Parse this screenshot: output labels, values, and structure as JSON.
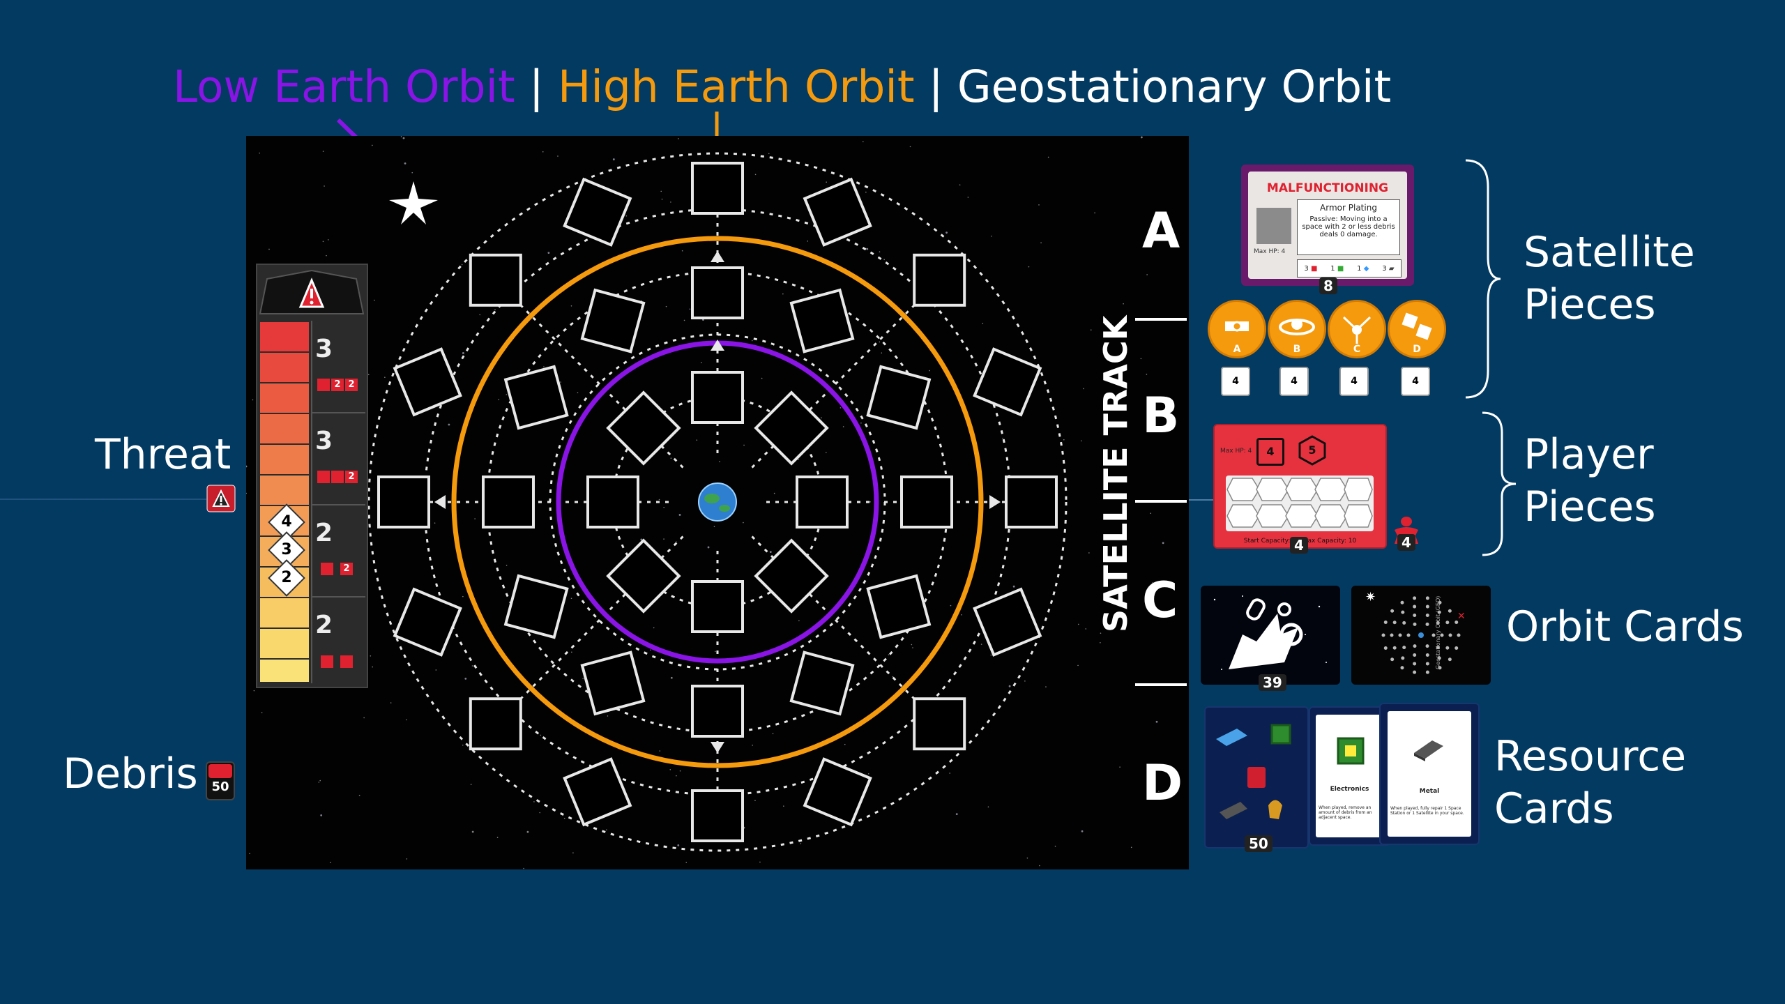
{
  "legend": {
    "leo": "Low Earth Orbit",
    "heo": "High Earth Orbit",
    "geo": "Geostationary Orbit",
    "separator": "|",
    "colors": {
      "leo": "#8a14e6",
      "heo": "#f59a0d",
      "geo": "#ffffff"
    }
  },
  "left_labels": {
    "threat": "Threat",
    "debris": "Debris",
    "debris_count": "50"
  },
  "satellite_track": {
    "label": "SATELLITE TRACK",
    "letters": [
      "A",
      "B",
      "C",
      "D"
    ]
  },
  "threat_track": {
    "rows": [
      {
        "value": "3",
        "cubes": [
          "2",
          "2"
        ]
      },
      {
        "value": "3",
        "cubes": [
          "",
          "",
          "2"
        ]
      },
      {
        "value": "2",
        "cubes": [
          "",
          "2"
        ]
      },
      {
        "value": "2",
        "cubes": [
          "",
          ""
        ]
      }
    ],
    "markers": [
      "4",
      "3",
      "2"
    ]
  },
  "satellite_pieces": {
    "label_line1": "Satellite",
    "label_line2": "Pieces",
    "card_title": "MALFUNCTIONING",
    "card_subtitle": "Armor Plating",
    "card_text": "Passive: Moving into a space with 2 or less debris deals 0 damage.",
    "card_maxhp": "Max HP: 4",
    "card_costs": [
      "3",
      "1",
      "1",
      "3"
    ],
    "card_count": "8",
    "tokens": [
      "A",
      "B",
      "C",
      "D"
    ],
    "token_counts": [
      "4",
      "4",
      "4",
      "4"
    ]
  },
  "player_pieces": {
    "label_line1": "Player",
    "label_line2": "Pieces",
    "board_maxhp": "Max HP: 4",
    "board_hp": "4",
    "board_hex": "5",
    "board_footer": "Start Capacity: 5 | Max Capacity: 10",
    "board_count": "4",
    "meeple_count": "4"
  },
  "orbit_cards": {
    "label": "Orbit Cards",
    "count": "39",
    "side_text": "Geostationary Orbit (GEO)"
  },
  "resource_cards": {
    "label_line1": "Resource",
    "label_line2": "Cards",
    "count": "50",
    "card1_title": "Electronics",
    "card1_text": "When played, remove an amount of debris from an adjacent space.",
    "card2_title": "Metal",
    "card2_text": "When played, fully repair 1 Space Station or 1 Satellite in your space."
  }
}
